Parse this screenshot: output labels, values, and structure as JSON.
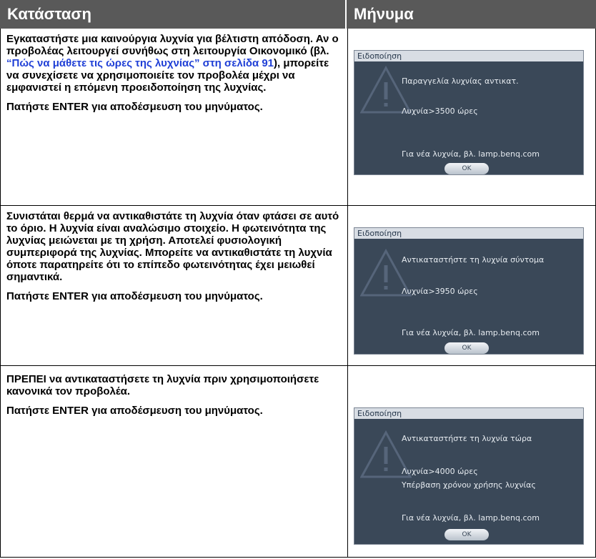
{
  "header": {
    "col_status": "Κατάσταση",
    "col_message": "Μήνυμα"
  },
  "rows": [
    {
      "text_a": "Εγκαταστήστε μια καινούργια λυχνία για βέλτιστη απόδοση. Αν ο προβολέας λειτουργεί συνήθως στη λειτουργία Οικονομικό (βλ. ",
      "link": "“Πώς να μάθετε τις ώρες της λυχνίας” στη σελίδα 91",
      "text_b": "), μπορείτε να συνεχίσετε να χρησιμοποιείτε τον προβολέα μέχρι να εμφανιστεί η επόμενη προειδοποίηση της λυχνίας.",
      "enter": "Πατήστε ENTER για αποδέσμευση του μηνύματος.",
      "osd": {
        "title": "Ειδοποίηση",
        "heading": "Παραγγελία λυχνίας αντικατ.",
        "hours": "Λυχνία>3500 ώρες",
        "extra": "",
        "url": "Για νέα λυχνία, βλ. lamp.benq.com",
        "ok": "OK"
      }
    },
    {
      "text_a": "Συνιστάται θερμά να αντικαθιστάτε τη λυχνία όταν φτάσει σε αυτό το όριο. Η λυχνία είναι αναλώσιμο στοιχείο. Η φωτεινότητα της λυχνίας μειώνεται με τη χρήση. Αποτελεί φυσιολογική συμπεριφορά της λυχνίας. Μπορείτε να αντικαθιστάτε τη λυχνία όποτε παρατηρείτε ότι το επίπεδο φωτεινότητας έχει μειωθεί σημαντικά.",
      "enter": "Πατήστε ENTER για αποδέσμευση του μηνύματος.",
      "osd": {
        "title": "Ειδοποίηση",
        "heading": "Αντικαταστήστε τη λυχνία σύντομα",
        "hours": "Λυχνία>3950 ώρες",
        "extra": "",
        "url": "Για νέα λυχνία, βλ. lamp.benq.com",
        "ok": "OK"
      }
    },
    {
      "text_a": "ΠΡΕΠΕΙ να αντικαταστήσετε τη λυχνία πριν χρησιμοποιήσετε κανονικά τον προβολέα.",
      "enter": "Πατήστε ENTER για αποδέσμευση του μηνύματος.",
      "osd": {
        "title": "Ειδοποίηση",
        "heading": "Αντικαταστήστε τη λυχνία τώρα",
        "hours": "Λυχνία>4000 ώρες",
        "extra": "Υπέρβαση χρόνου χρήσης λυχνίας",
        "url": "Για νέα λυχνία, βλ. lamp.benq.com",
        "ok": "OK"
      }
    }
  ],
  "colors": {
    "header_bg": "#595959",
    "link": "#1f3fd6",
    "osd_bg": "#3a4858"
  }
}
